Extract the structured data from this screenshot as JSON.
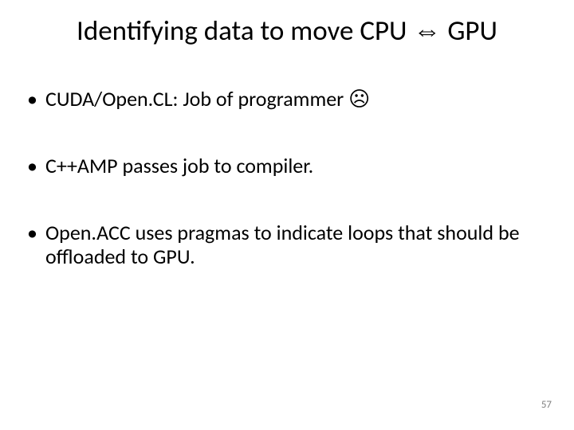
{
  "title": "Identifying data to move CPU ⇔ GPU",
  "bullets": [
    "CUDA/Open.CL:  Job of programmer ☹",
    "C++AMP passes job to compiler.",
    "Open.ACC uses pragmas to indicate loops that should be offloaded to GPU."
  ],
  "page_number": "57"
}
